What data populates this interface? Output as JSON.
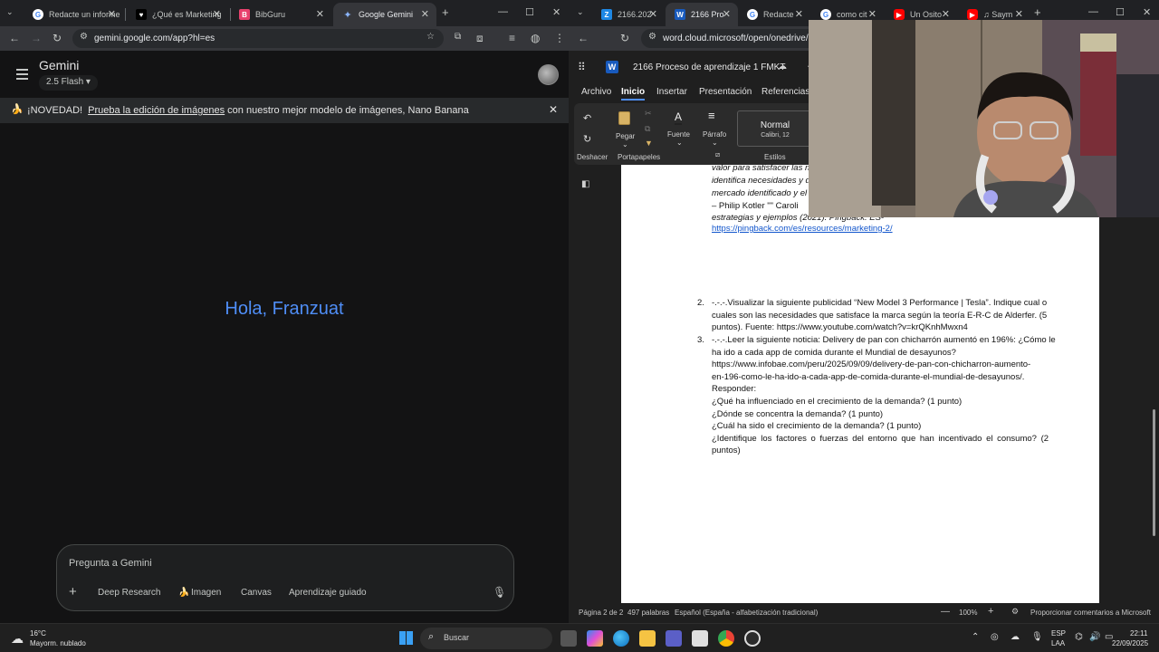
{
  "left_browser": {
    "tabs": [
      {
        "title": "Redacte un informe",
        "icon": "google-icon"
      },
      {
        "title": "¿Qué es Marketing",
        "icon": "site-icon"
      },
      {
        "title": "BibGuru",
        "icon": "bibguru-icon"
      },
      {
        "title": "Google Gemini",
        "icon": "gemini-icon",
        "active": true
      }
    ],
    "url": "gemini.google.com/app?hl=es"
  },
  "gemini": {
    "title": "Gemini",
    "model": "2.5 Flash",
    "banner_prefix": "¡NOVEDAD!",
    "banner_link": "Prueba la edición de imágenes",
    "banner_suffix": "con nuestro mejor modelo de imágenes, Nano Banana",
    "greeting": "Hola, Franzuat",
    "prompt_placeholder": "Pregunta a Gemini",
    "tools": [
      "Deep Research",
      "Imagen",
      "Canvas",
      "Aprendizaje guiado"
    ]
  },
  "right_browser": {
    "tabs": [
      {
        "title": "2166.202",
        "icon": "z-icon"
      },
      {
        "title": "2166 Pro",
        "icon": "word-icon",
        "active": true
      },
      {
        "title": "Redacte",
        "icon": "google-icon"
      },
      {
        "title": "como cit",
        "icon": "google-icon"
      },
      {
        "title": "Un Osito",
        "icon": "youtube-icon"
      },
      {
        "title": "♫ Saym",
        "icon": "youtube-icon"
      }
    ],
    "url": "word.cloud.microsoft/open/onedrive/?e"
  },
  "word": {
    "doc_title": "2166 Proceso de aprendizaje 1 FMKT",
    "menu": [
      "Archivo",
      "Inicio",
      "Insertar",
      "Presentación",
      "Referencias"
    ],
    "active_menu": "Inicio",
    "ribbon": {
      "undo_group": "Deshacer",
      "paste": "Pegar",
      "clipboard_group": "Portapapeles",
      "font": "Fuente",
      "paragraph": "Párrafo",
      "style_name": "Normal",
      "style_font": "Calibri, 12",
      "styles_group": "Estilos"
    },
    "quote_lines": [
      "valor para satisfacer las n",
      "identifica necesidades y d",
      "mercado identificado y el"
    ],
    "quote_author": "– Philip Kotler \"\" Caroli",
    "quote_source": "estrategias y ejemplos (2021). Pingback. ES-",
    "quote_link": "https://pingback.com/es/resources/marketing-2/",
    "q2_num": "2.",
    "q2_lines": [
      "-.-.-.Visualizar la siguiente publicidad “New Model 3 Performance | Tesla”. Indique cual o",
      "cuales son las necesidades que satisface la marca según la teoría E-R-C de Alderfer. (5",
      "puntos). Fuente: https://www.youtube.com/watch?v=krQKnhMwxn4"
    ],
    "q3_num": "3.",
    "q3_lines": [
      "-.-.-.Leer la siguiente noticia: Delivery de pan con chicharrón aumentó en 196%: ¿Cómo le",
      "ha ido a cada app de comida durante el Mundial de desayunos?",
      "https://www.infobae.com/peru/2025/09/09/delivery-de-pan-con-chicharron-aumento-",
      "en-196-como-le-ha-ido-a-cada-app-de-comida-durante-el-mundial-de-desayunos/.",
      "Responder:",
      "¿Qué ha influenciado en el crecimiento de la demanda? (1 punto)",
      "¿Dónde se concentra la demanda? (1 punto)",
      "¿Cuál ha sido el crecimiento de la demanda? (1 punto)",
      "¿Identifique los factores o fuerzas del entorno que han incentivado el consumo? (2",
      "puntos)"
    ],
    "status": {
      "page": "Página 2 de 2",
      "words": "497 palabras",
      "language": "Español (España - alfabetización tradicional)",
      "zoom": "100%",
      "feedback": "Proporcionar comentarios a Microsoft"
    }
  },
  "taskbar": {
    "weather_temp": "16°C",
    "weather_desc": "Mayorm. nublado",
    "search_placeholder": "Buscar",
    "lang": "ESP",
    "lang_sub": "LAA",
    "time": "22:11",
    "date": "22/09/2025"
  },
  "colors": {
    "gemini_greeting": "#4f8ef7",
    "word_blue": "#185abd",
    "link_blue": "#1155cc"
  }
}
